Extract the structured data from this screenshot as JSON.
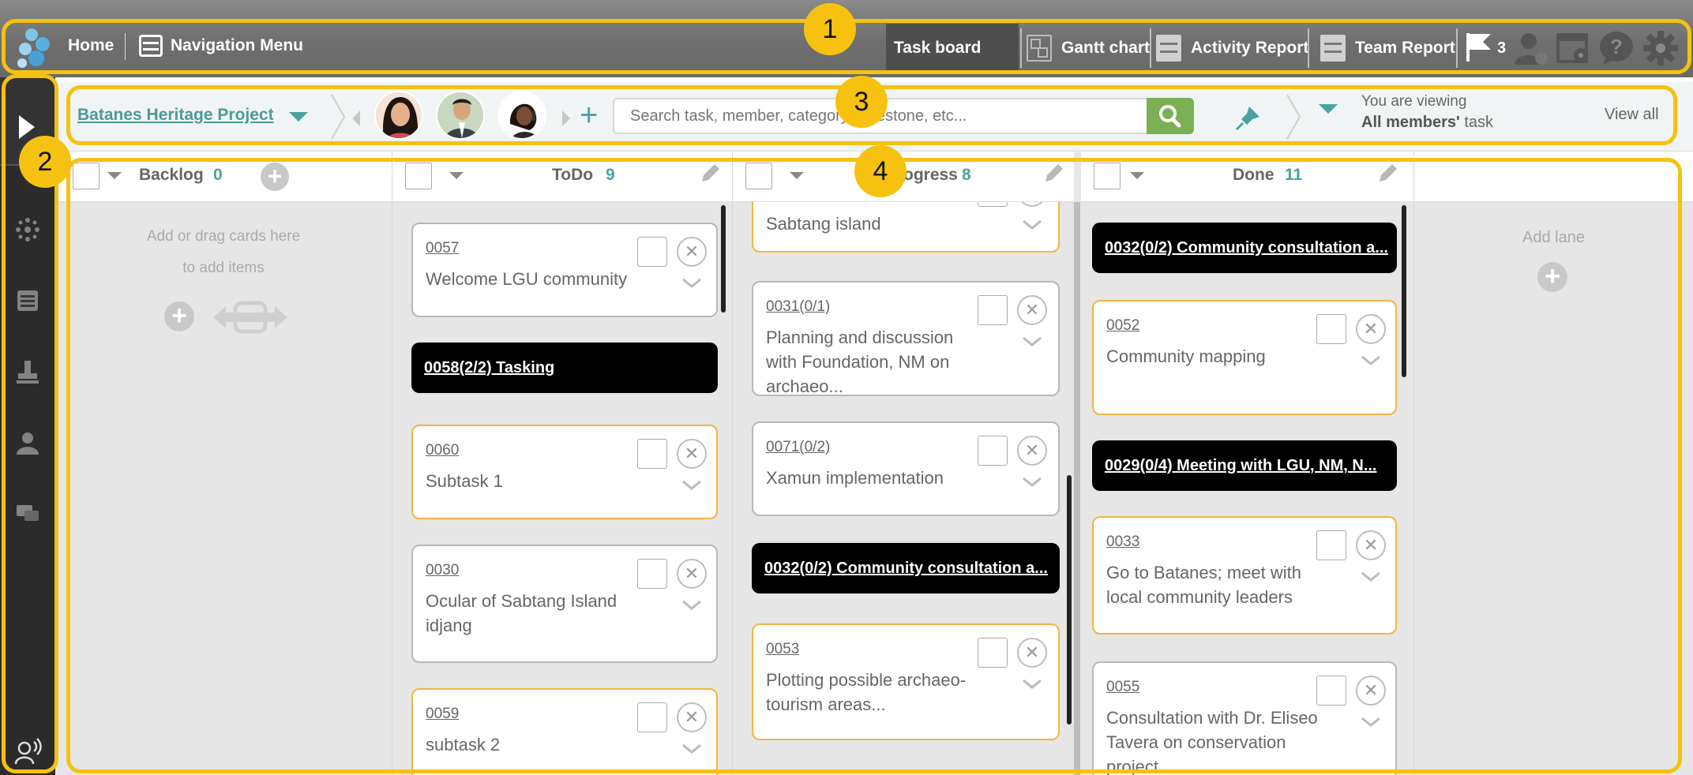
{
  "topbar": {
    "home": "Home",
    "navigation_menu": "Navigation Menu",
    "tabs": [
      {
        "label": "Task board",
        "active": true
      },
      {
        "label": "Gantt chart",
        "active": false
      },
      {
        "label": "Activity Report",
        "active": false
      },
      {
        "label": "Team Report",
        "active": false
      }
    ],
    "flag_count": "3"
  },
  "project_bar": {
    "project_name": "Batanes Heritage Project",
    "search_placeholder": "Search task, member, category, milestone, etc...",
    "viewing_line1": "You are viewing",
    "viewing_bold": "All members'",
    "viewing_rest": " task",
    "view_all": "View all"
  },
  "board": {
    "lanes": [
      {
        "title": "Backlog",
        "count": "0",
        "hint1": "Add or drag cards here",
        "hint2": "to add items"
      },
      {
        "title": "ToDo",
        "count": "9"
      },
      {
        "title": "ogress",
        "count": "8"
      },
      {
        "title": "Done",
        "count": "11"
      }
    ],
    "add_lane": "Add lane",
    "todo_cards": [
      {
        "id": "0057",
        "title": "Welcome LGU community"
      },
      {
        "parent": "0058(2/2) Tasking"
      },
      {
        "id": "0060",
        "title": "Subtask 1"
      },
      {
        "id": "0030",
        "title": "Ocular of Sabtang Island idjang"
      },
      {
        "id": "0059",
        "title": "subtask 2"
      }
    ],
    "progress_cards": [
      {
        "title": "Sabtang island"
      },
      {
        "id": "0031(0/1)",
        "title": "Planning and discussion with Foundation, NM on archaeo..."
      },
      {
        "id": "0071(0/2)",
        "title": "Xamun implementation"
      },
      {
        "parent": "0032(0/2) Community consultation a..."
      },
      {
        "id": "0053",
        "title": "Plotting possible archaeo-tourism areas..."
      }
    ],
    "done_cards": [
      {
        "parent": "0032(0/2) Community consultation a..."
      },
      {
        "id": "0052",
        "title": "Community mapping"
      },
      {
        "parent": "0029(0/4) Meeting with LGU, NM, N..."
      },
      {
        "id": "0033",
        "title": "Go to Batanes; meet with local community leaders"
      },
      {
        "id": "0055",
        "title": "Consultation with Dr. Eliseo Tavera on conservation project"
      }
    ]
  },
  "annotations": [
    "1",
    "2",
    "3",
    "4"
  ],
  "colors": {
    "highlight": "#f4c210",
    "accent": "#4aa2a0",
    "search_button": "#7bb055",
    "orange_border": "#f2b445"
  }
}
